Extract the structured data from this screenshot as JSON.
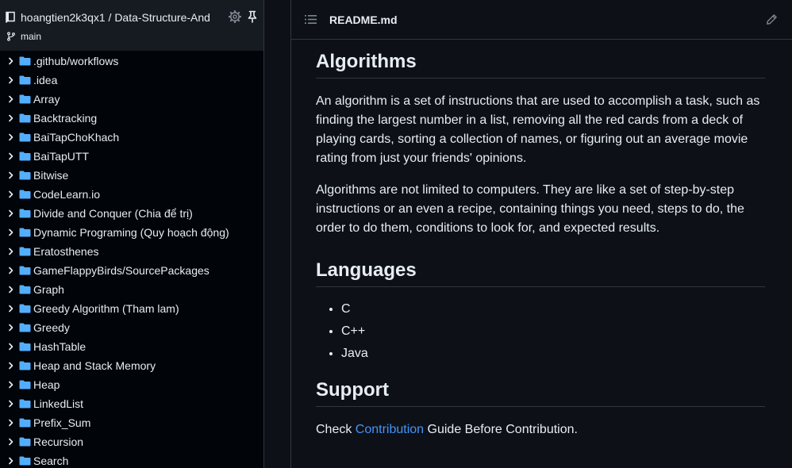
{
  "sidebar": {
    "repo_title": "hoangtien2k3qx1 / Data-Structure-And",
    "branch": "main",
    "items": [
      {
        "label": ".github/workflows"
      },
      {
        "label": ".idea"
      },
      {
        "label": "Array"
      },
      {
        "label": "Backtracking"
      },
      {
        "label": "BaiTapChoKhach"
      },
      {
        "label": "BaiTapUTT"
      },
      {
        "label": "Bitwise"
      },
      {
        "label": "CodeLearn.io"
      },
      {
        "label": "Divide and Conquer (Chia để trị)"
      },
      {
        "label": "Dynamic Programing (Quy hoạch động)"
      },
      {
        "label": "Eratosthenes"
      },
      {
        "label": "GameFlappyBirds/SourcePackages"
      },
      {
        "label": "Graph"
      },
      {
        "label": "Greedy Algorithm (Tham lam)"
      },
      {
        "label": "Greedy"
      },
      {
        "label": "HashTable"
      },
      {
        "label": "Heap and Stack Memory"
      },
      {
        "label": "Heap"
      },
      {
        "label": "LinkedList"
      },
      {
        "label": "Prefix_Sum"
      },
      {
        "label": "Recursion"
      },
      {
        "label": "Search"
      }
    ]
  },
  "file": {
    "title": "README.md"
  },
  "readme": {
    "algorithms_heading": "Algorithms",
    "algorithms_p1": "An algorithm is a set of instructions that are used to accomplish a task, such as finding the largest number in a list, removing all the red cards from a deck of playing cards, sorting a collection of names, or figuring out an average movie rating from just your friends' opinions.",
    "algorithms_p2": "Algorithms are not limited to computers. They are like a set of step-by-step instructions or an even a recipe, containing things you need, steps to do, the order to do them, conditions to look for, and expected results.",
    "languages_heading": "Languages",
    "languages": [
      "C",
      "C++",
      "Java"
    ],
    "support_heading": "Support",
    "support_prefix": "Check ",
    "support_link": "Contribution",
    "support_suffix": " Guide Before Contribution."
  },
  "colors": {
    "accent_link": "#4493f8",
    "folder": "#54aeff",
    "background": "#0d1117",
    "sidebar_bg": "#010409"
  }
}
